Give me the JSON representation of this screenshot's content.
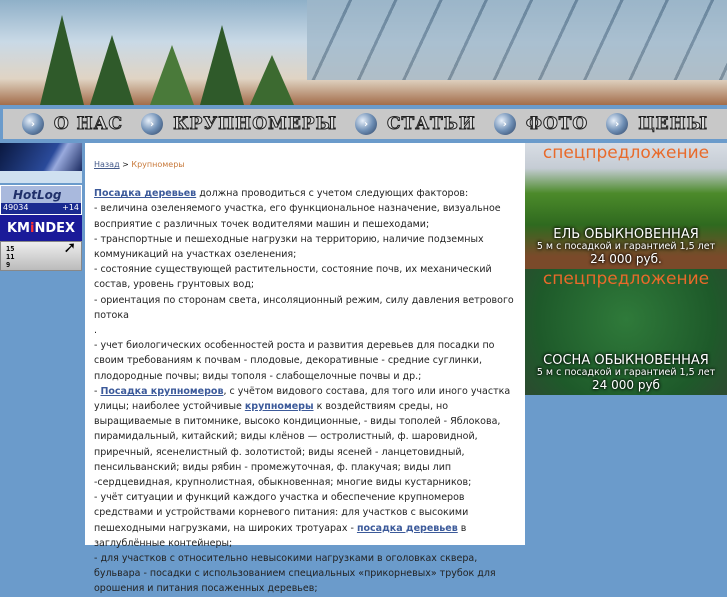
{
  "nav": [
    {
      "label": "О НАС"
    },
    {
      "label": "КРУПНОМЕРЫ"
    },
    {
      "label": "СТАТЬИ"
    },
    {
      "label": "ФОТО"
    },
    {
      "label": "ЦЕНЫ"
    }
  ],
  "counters": {
    "hotlog": {
      "label": "HotLog",
      "total": "49034",
      "today": "+14"
    },
    "kmindex": {
      "label_a": "KM",
      "label_b": "i",
      "label_c": "NDEX",
      "stats": [
        "15",
        "11",
        "9"
      ]
    }
  },
  "breadcrumb": {
    "back": "Назад",
    "sep": " > ",
    "current": "Крупномеры"
  },
  "article": {
    "p1_link": "Посадка деревьев",
    "p1": " должна проводиться с учетом следующих факторов:",
    "l1": "- величина озеленяемого участка, его функциональное назначение, визуальное восприятие с различных точек водителями машин и пешеходами;",
    "l2": "- транспортные и пешеходные нагрузки на территорию, наличие подземных коммуникаций на участках озеленения;",
    "l3": "- состояние существующей растительности, состояние почв, их механический состав, уровень грунтовых вод;",
    "l4": "- ориентация по сторонам света, инсоляционный режим, силу давления ветрового потока",
    "l4b": ".",
    "l5": "- учет биологических особенностей роста и развития деревьев для посадки по своим требованиям к почвам - плодовые, декоративные - средние суглинки, плодородные почвы; виды тополя - слабощелочные почвы и др.;",
    "l6_pre": "- ",
    "l6_link": "Посадка крупномеров",
    "l6_mid": ", с учётом видового состава, для того или иного участка улицы; наиболее устойчивые ",
    "l6_link2": "крупномеры",
    "l6_end": " к воздействиям среды, но выращиваемые в питомнике, высоко кондиционные, - виды тополей - Яблокова, пирамидальный, китайский; виды клёнов — остролистный, ф. шаровидной, приречный, ясенелистный ф. золотистой; виды ясеней - ланцетовидный, пенсильванский; виды рябин - промежуточная, ф. плакучая; виды лип -сердцевидная, крупнолистная, обыкновенная; многие виды кустарников;",
    "l7": "- учёт ситуации и функций каждого участка и обеспечение крупномеров средствами и устройствами корневого питания: для участков с высокими пешеходными нагрузками, на широких тротуарах - ",
    "l7_link": "посадка деревьев",
    "l7_end": " в заглублённые контейнеры;",
    "l8": "- для участков с относительно невысокими нагрузками в оголовках сквера, бульвара - посадки с использованием специальных «прикорневых» трубок для орошения и питания посаженных деревьев;"
  },
  "promos": [
    {
      "tag": "спецпредложение",
      "title": "ЕЛЬ ОБЫКНОВЕННАЯ",
      "desc": "5 м с посадкой и гарантией 1,5 лет",
      "price": "24 000 руб."
    },
    {
      "tag": "спецпредложение",
      "title": "СОСНА ОБЫКНОВЕННАЯ",
      "desc": "5 м с посадкой и гарантией 1,5 лет",
      "price": "24 000 руб"
    }
  ]
}
